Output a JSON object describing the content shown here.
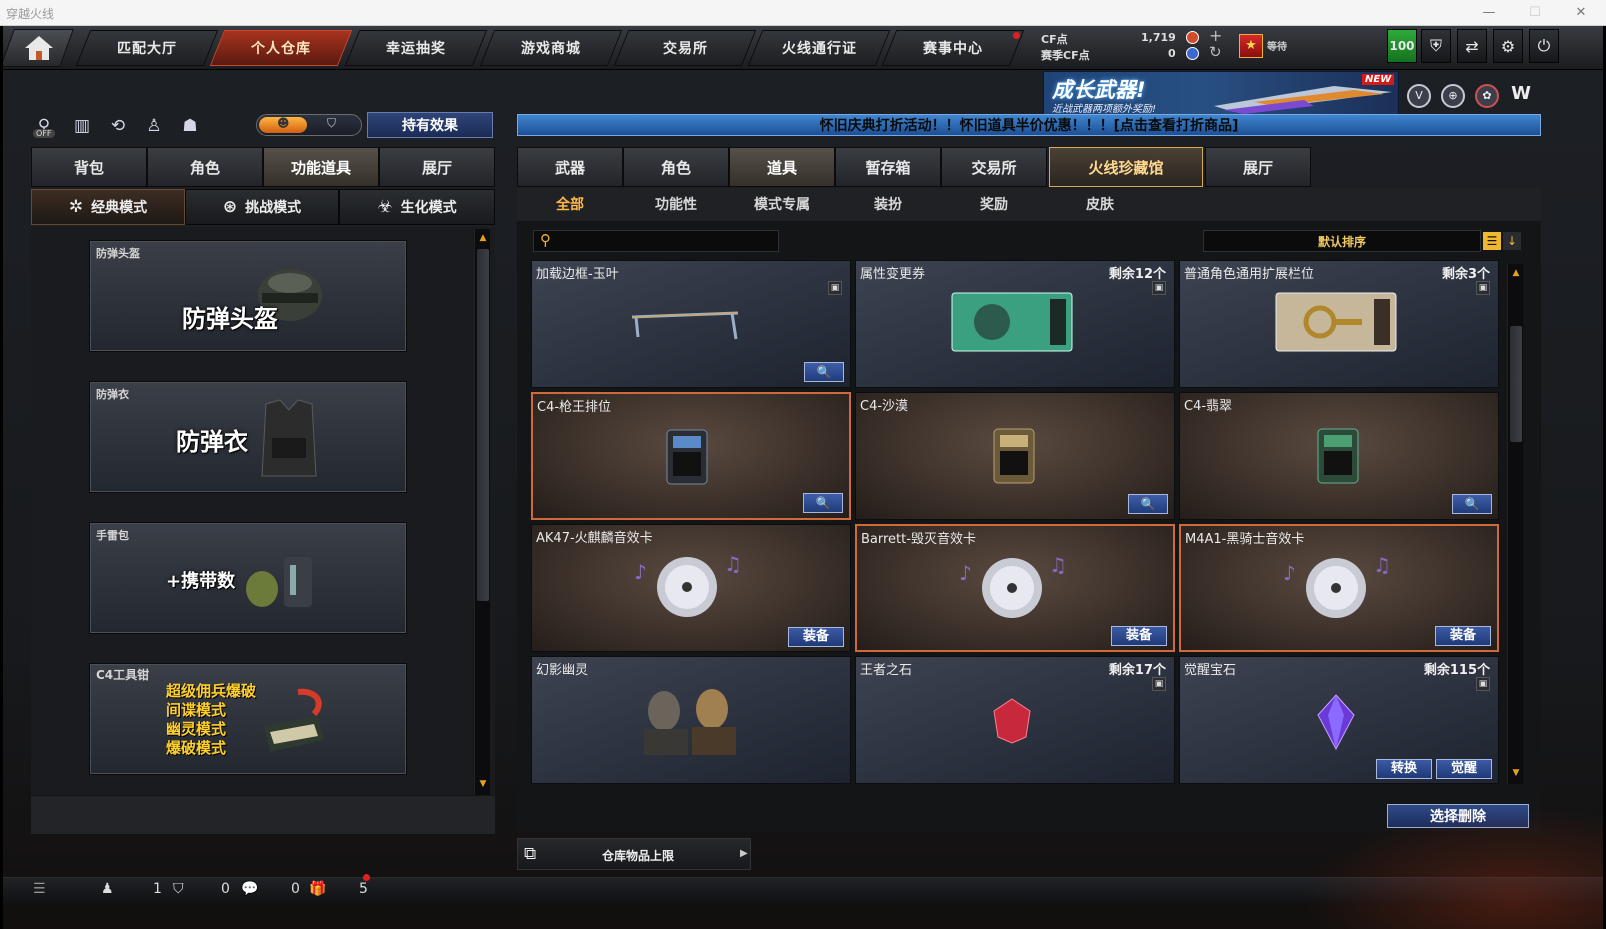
{
  "window": {
    "title": "穿越火线",
    "min": "—",
    "max": "☐",
    "close": "✕"
  },
  "topnav": {
    "home_icon": "home-icon",
    "tabs": [
      {
        "label": "匹配大厅"
      },
      {
        "label": "个人仓库"
      },
      {
        "label": "幸运抽奖"
      },
      {
        "label": "游戏商城"
      },
      {
        "label": "交易所"
      },
      {
        "label": "火线通行证"
      },
      {
        "label": "赛事中心"
      }
    ],
    "cf_label": "CF点",
    "cf_value": "1,719",
    "season_cf_label": "赛季CF点",
    "season_cf_value": "0",
    "plus": "+",
    "refresh": "↻",
    "rank_label": "等待",
    "level_badge": "100"
  },
  "banner": {
    "title": "成长武器!",
    "subtitle": "近战武器两项额外奖励!",
    "new_tag": "NEW"
  },
  "left": {
    "off_label": "OFF",
    "effects_button": "持有效果",
    "tabs": [
      {
        "label": "背包"
      },
      {
        "label": "角色"
      },
      {
        "label": "功能道具"
      },
      {
        "label": "展厅"
      }
    ],
    "modes": [
      {
        "label": "经典模式"
      },
      {
        "label": "挑战模式"
      },
      {
        "label": "生化模式"
      }
    ],
    "cards": [
      {
        "title": "防弹头盔",
        "big": "防弹头盔"
      },
      {
        "title": "防弹衣",
        "big": "防弹衣"
      },
      {
        "title": "手雷包",
        "big": "+携带数"
      },
      {
        "title": "C4工具钳",
        "lines": [
          "超级佣兵爆破",
          "间谍模式",
          "幽灵模式",
          "爆破模式"
        ]
      }
    ]
  },
  "right": {
    "notice": "怀旧庆典打折活动！！怀旧道具半价优惠！！！[点击查看打折商品]",
    "tabs": [
      {
        "label": "武器"
      },
      {
        "label": "角色"
      },
      {
        "label": "道具"
      },
      {
        "label": "暂存箱"
      },
      {
        "label": "交易所"
      },
      {
        "label": "火线珍藏馆"
      },
      {
        "label": "展厅"
      }
    ],
    "subtabs": [
      {
        "label": "全部"
      },
      {
        "label": "功能性"
      },
      {
        "label": "模式专属"
      },
      {
        "label": "装扮"
      },
      {
        "label": "奖励"
      },
      {
        "label": "皮肤"
      }
    ],
    "search_placeholder": "",
    "sort_label": "默认排序",
    "items": [
      {
        "name": "加载边框-玉叶",
        "remain": ""
      },
      {
        "name": "属性变更券",
        "remain": "剩余12个"
      },
      {
        "name": "普通角色通用扩展栏位",
        "remain": "剩余3个"
      },
      {
        "name": "C4-枪王排位",
        "remain": ""
      },
      {
        "name": "C4-沙漠",
        "remain": ""
      },
      {
        "name": "C4-翡翠",
        "remain": ""
      },
      {
        "name": "AK47-火麒麟音效卡",
        "remain": "",
        "button": "装备"
      },
      {
        "name": "Barrett-毁灭音效卡",
        "remain": "",
        "button": "装备"
      },
      {
        "name": "M4A1-黑骑士音效卡",
        "remain": "",
        "button": "装备"
      },
      {
        "name": "幻影幽灵",
        "remain": ""
      },
      {
        "name": "王者之石",
        "remain": "剩余17个"
      },
      {
        "name": "觉醒宝石",
        "remain": "剩余115个",
        "button": "转换",
        "button2": "觉醒"
      }
    ],
    "delete_button": "选择删除",
    "capacity_label": "仓库物品上限"
  },
  "bottom": {
    "count1": "1",
    "count2": "0",
    "count3": "0",
    "count4": "5"
  },
  "colors": {
    "accent": "#a8331d",
    "blue_button": "#2c4a92",
    "notice": "#2f6fb6",
    "gold": "#d3a95a"
  }
}
